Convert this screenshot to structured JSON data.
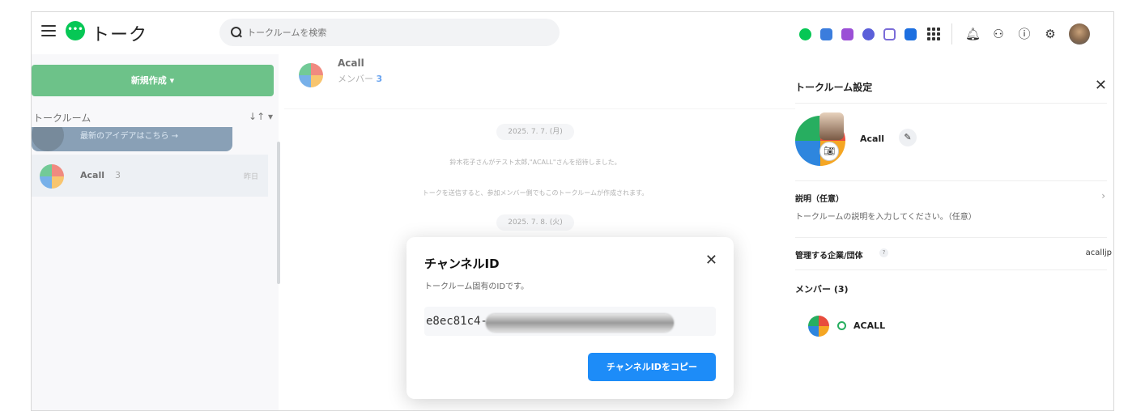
{
  "app": {
    "title": "トーク",
    "logo": "line-chat-logo"
  },
  "search": {
    "placeholder": "トークルームを検索"
  },
  "toolbar": {
    "app_icons": [
      {
        "name": "line-chat-app-icon",
        "color": "#06c755"
      },
      {
        "name": "calendar-app-icon",
        "color": "#3b7ddd"
      },
      {
        "name": "notes-app-icon",
        "color": "#9b4fd6"
      },
      {
        "name": "survey-app-icon",
        "color": "#5b5fd9"
      },
      {
        "name": "form-app-icon",
        "color": "#7a6cd8"
      },
      {
        "name": "contacts-app-icon",
        "color": "#1d6fe0"
      }
    ],
    "utility_icons": [
      "app-grid-icon",
      "bell-icon",
      "org-chart-icon",
      "help-icon",
      "gear-icon",
      "user-avatar"
    ]
  },
  "sidebar": {
    "new_button_label": "新規作成 ▾",
    "section_label": "トークルーム",
    "sort_label": "↓↑ ▾",
    "banner_text": "最新のアイデアはこちら →",
    "rooms": [
      {
        "name": "Acall",
        "count": "3",
        "time": "昨日"
      }
    ]
  },
  "chat": {
    "name": "Acall",
    "members_prefix": "メンバー",
    "members_count": "3",
    "date1": "2025. 7. 7. (月)",
    "msg1": "鈴木花子さんがテスト太郎,\"ACALL\"さんを招待しました。",
    "msg2": "トークを送信すると、参加メンバー側でもこのトークルームが作成されます。",
    "date2": "2025. 7. 8. (火)"
  },
  "settings": {
    "title": "トークルーム設定",
    "room_name": "Acall",
    "description_label": "説明（任意）",
    "description_placeholder": "トークルームの説明を入力してください。（任意）",
    "org_label": "管理する企業/団体",
    "org_value": "acalljp",
    "members_label": "メンバー (3)",
    "member_name": "ACALL"
  },
  "modal": {
    "title": "チャンネルID",
    "subtitle": "トークルーム固有のIDです。",
    "id_visible": "e8ec81c4-",
    "copy_button": "チャンネルIDをコピー"
  },
  "colors": {
    "accent_green": "#1fa24a",
    "primary_blue": "#1d8cf8",
    "link_blue": "#1a73e8"
  }
}
